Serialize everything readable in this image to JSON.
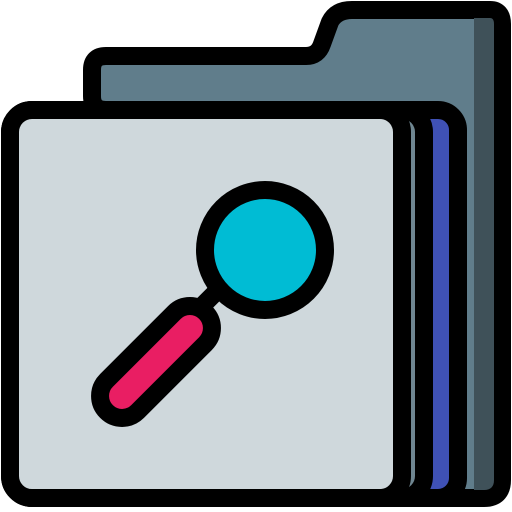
{
  "icon": {
    "name": "folder-search-icon",
    "colors": {
      "outline": "#000000",
      "back_folder": "#607d8b",
      "back_folder_shadow": "#3f5159",
      "front_sheet": "#cfd8dc",
      "front_sheet_edge": "#6f8691",
      "blue_sheet": "#3f51b5",
      "lens": "#00bcd4",
      "handle": "#e91e63"
    }
  }
}
